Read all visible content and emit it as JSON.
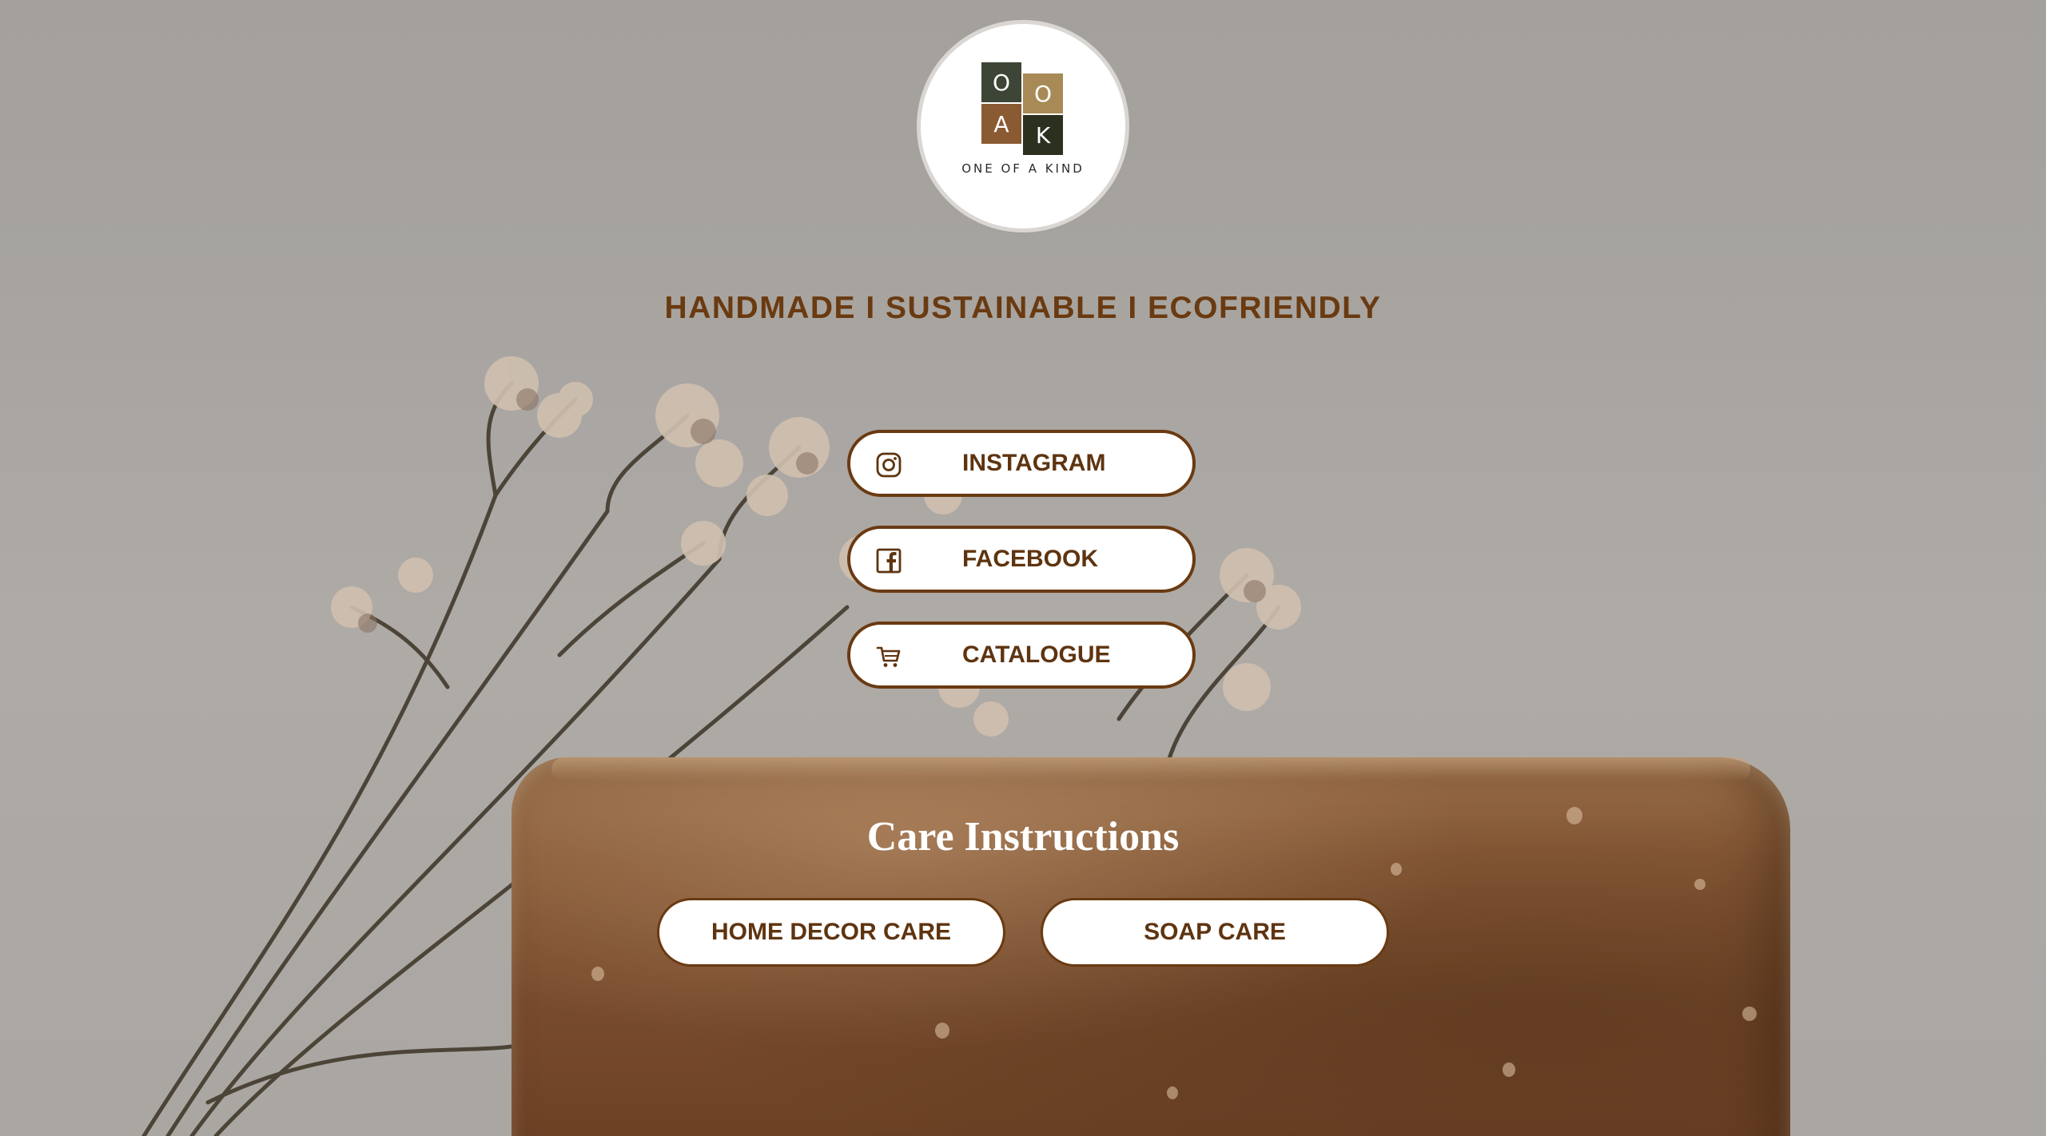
{
  "brand": {
    "logo_letters": [
      "O",
      "O",
      "A",
      "K"
    ],
    "logo_tagline": "ONE OF A KIND"
  },
  "tagline": "HANDMADE I SUSTAINABLE I ECOFRIENDLY",
  "links": [
    {
      "label": "INSTAGRAM",
      "icon": "instagram-icon"
    },
    {
      "label": "FACEBOOK",
      "icon": "facebook-icon"
    },
    {
      "label": "CATALOGUE",
      "icon": "cart-icon"
    }
  ],
  "care": {
    "heading": "Care Instructions",
    "buttons": [
      {
        "label": "HOME DECOR CARE"
      },
      {
        "label": "SOAP CARE"
      }
    ]
  },
  "colors": {
    "brand_brown": "#6a3a11",
    "button_bg": "#ffffff",
    "logo_tile_green": "#3d4536",
    "logo_tile_gold": "#a78a55",
    "logo_tile_brown": "#8a5a33",
    "logo_tile_dark": "#2c301f"
  }
}
